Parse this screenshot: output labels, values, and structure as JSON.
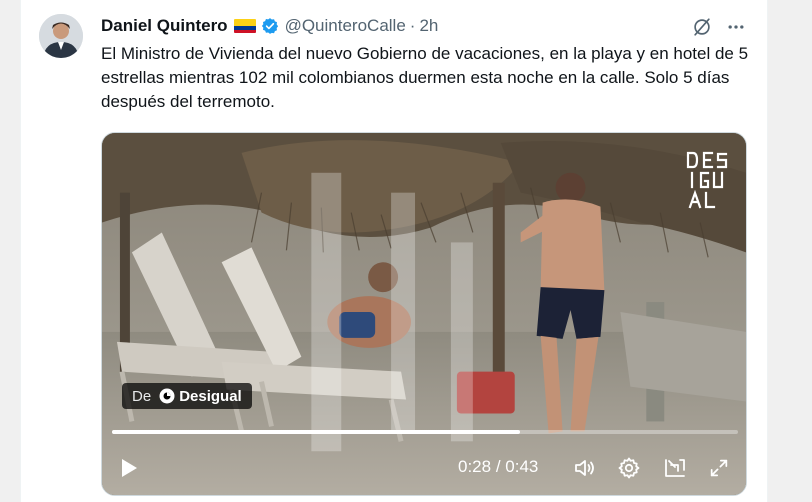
{
  "tweet": {
    "author_name": "Daniel Quintero",
    "handle": "@QuinteroCalle",
    "separator": "·",
    "time": "2h",
    "text": "El Ministro de Vivienda del nuevo Gobierno de vacaciones, en la playa y en hotel de 5 estrellas mientras 102 mil colombianos duermen esta noche en la calle. Solo 5 días después del terremoto."
  },
  "video": {
    "source_prefix": "De",
    "source_name": "Desigual",
    "current_time": "0:28",
    "time_separator": " / ",
    "duration": "0:43",
    "progress_fraction": 0.6512,
    "watermark_text": "DESIGUAL"
  },
  "icons": {
    "author_badge": "verified-badge-icon",
    "flag": "colombia-flag-icon",
    "grok": "grok-icon",
    "more": "more-icon",
    "play": "play-icon",
    "volume": "volume-icon",
    "settings": "settings-icon",
    "pip": "picture-in-picture-icon",
    "fullscreen": "fullscreen-icon"
  },
  "colors": {
    "accent": "#1d9bf0",
    "text_primary": "#0f1419",
    "text_secondary": "#536471"
  }
}
